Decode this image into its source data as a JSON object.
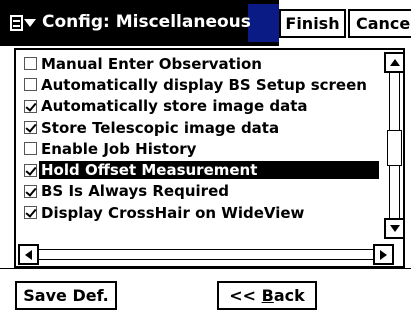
{
  "titlebar": {
    "title": "Config: Miscellaneous",
    "menu_icon": "document-menu-icon",
    "finish_label": "Finish",
    "cancel_label": "Cancel",
    "background": "#000000",
    "accent": "#0a1b86"
  },
  "list": {
    "items": [
      {
        "label": "Manual Enter Observation",
        "checked": false,
        "selected": false
      },
      {
        "label": "Automatically display BS Setup screen",
        "checked": false,
        "selected": false
      },
      {
        "label": "Automatically store image data",
        "checked": true,
        "selected": false
      },
      {
        "label": "Store Telescopic image data",
        "checked": true,
        "selected": false
      },
      {
        "label": "Enable Job History",
        "checked": false,
        "selected": false
      },
      {
        "label": "Hold Offset Measurement",
        "checked": true,
        "selected": true
      },
      {
        "label": "BS Is Always Required",
        "checked": true,
        "selected": false
      },
      {
        "label": "Display CrossHair on WideView",
        "checked": true,
        "selected": false
      }
    ]
  },
  "bottombar": {
    "save_def_label": "Save Def.",
    "back_prefix": "<< ",
    "back_accel": "B",
    "back_rest": "ack"
  }
}
